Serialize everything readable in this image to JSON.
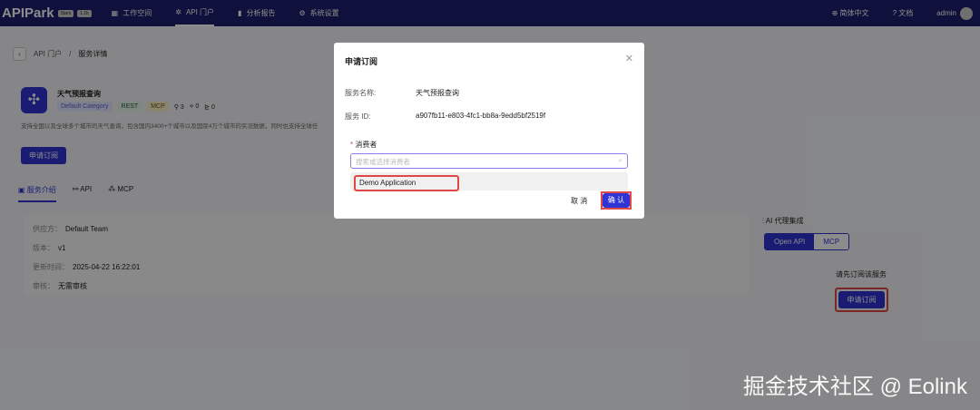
{
  "header": {
    "logo": "APIPark",
    "stars_label": "Stars",
    "stars_count": "1.1k",
    "nav": [
      "工作空间",
      "API 门户",
      "分析报告",
      "系统设置"
    ],
    "language": "简体中文",
    "docs": "文档",
    "user": "admin"
  },
  "breadcrumb": {
    "root": "API 门户",
    "sep": "/",
    "current": "服务详情"
  },
  "service": {
    "name": "天气预报查询",
    "category": "Default Category",
    "tags": [
      "REST",
      "MCP"
    ],
    "stats": [
      "3",
      "0",
      "0"
    ],
    "description": "支持全国以及全球多个城市的天气查询，包含国内3400+个城市以及国际4万个城市的实况数据，同时也支持全球任",
    "subscribe": "申请订阅"
  },
  "tabs": [
    "服务介绍",
    "API",
    "MCP"
  ],
  "info": [
    {
      "k": "供应方：",
      "v": "Default Team"
    },
    {
      "k": "版本：",
      "v": "v1"
    },
    {
      "k": "更新时间：",
      "v": "2025-04-22 16:22:01"
    },
    {
      "k": "审核：",
      "v": "无需审核"
    }
  ],
  "right": {
    "title": "AI 代理集成",
    "seg": [
      "Open API",
      "MCP"
    ],
    "hint": "请先订阅该服务",
    "button": "申请订阅"
  },
  "modal": {
    "title": "申请订阅",
    "name_label": "服务名称:",
    "name": "天气预报查询",
    "id_label": "服务 ID:",
    "id": "a907fb11-e803-4fc1-bb8a-9edd5bf2519f",
    "consumer_label": "消费者",
    "placeholder": "搜索或选择消费者",
    "option": "Demo Application",
    "cancel": "取 消",
    "confirm": "确 认"
  },
  "watermark": "掘金技术社区 @ Eolink"
}
